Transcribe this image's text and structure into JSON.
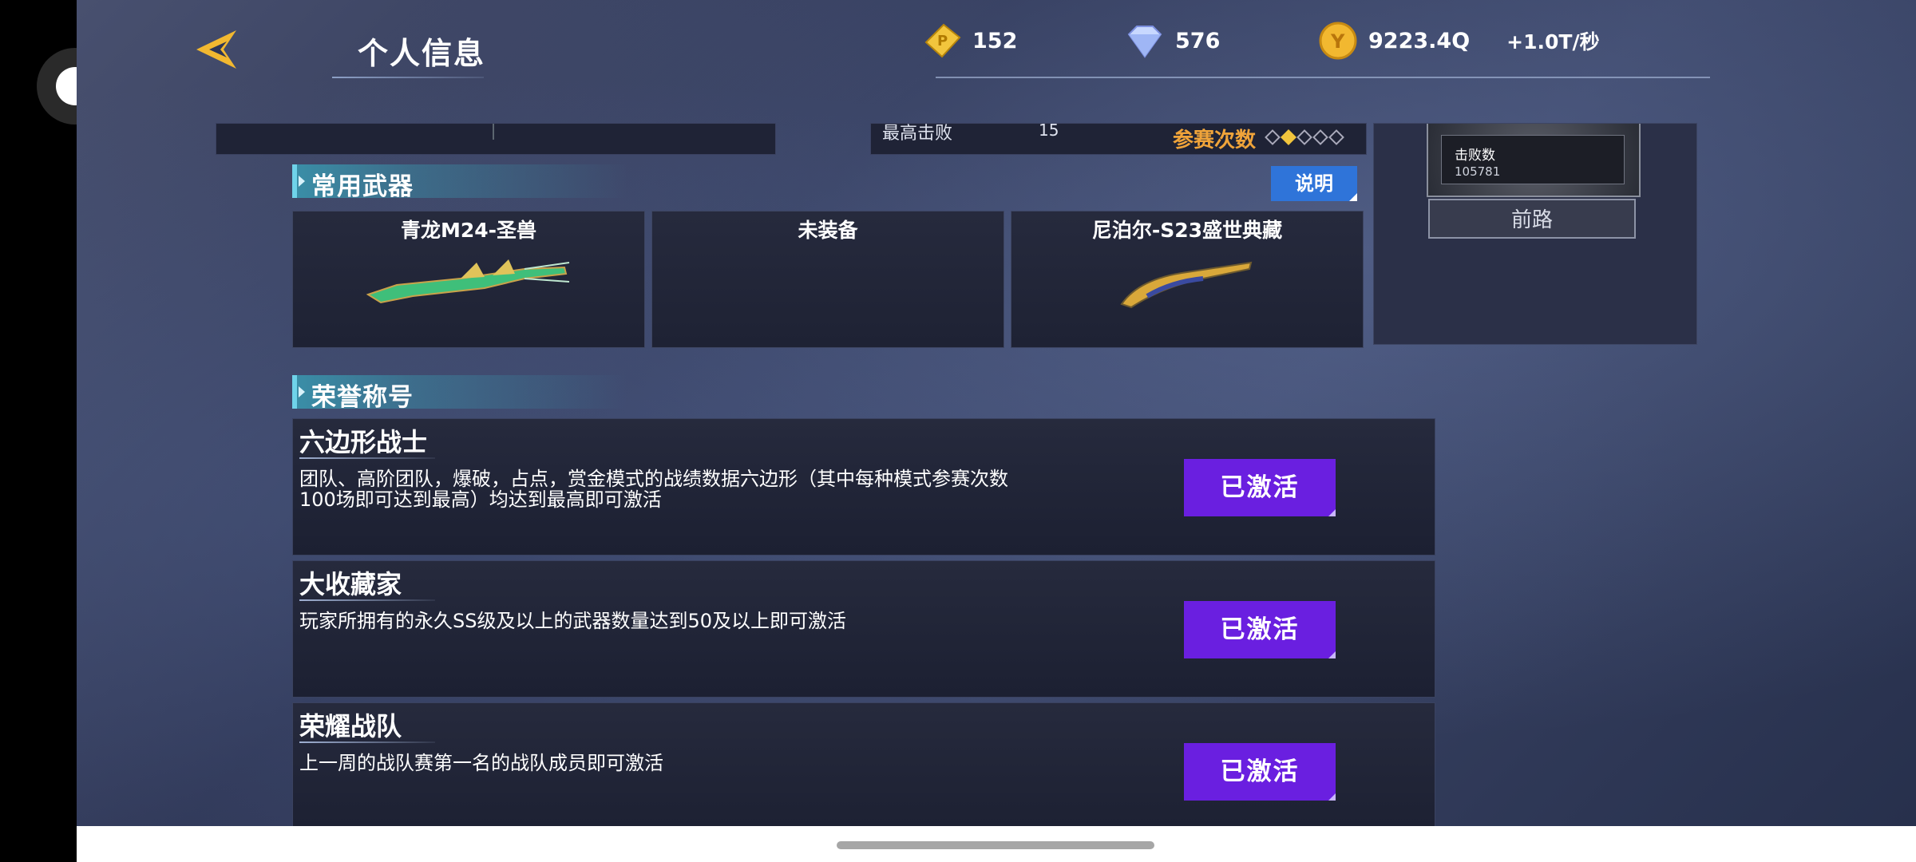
{
  "header": {
    "title": "个人信息",
    "resources": [
      {
        "icon": "gold-ticket-icon",
        "value": "152"
      },
      {
        "icon": "diamond-icon",
        "value": "576"
      },
      {
        "icon": "gold-coin-icon",
        "value": "9223.4Q",
        "rate": "+1.0T/秒"
      }
    ]
  },
  "stats": {
    "label": "最高击败",
    "value": "15",
    "matches_label": "参赛次数",
    "matches_level": 1,
    "matches_max": 5
  },
  "side_card": {
    "kills_label": "击败数",
    "kills_value": "105781",
    "button": "前路"
  },
  "weapons_section": {
    "title": "常用武器",
    "help_button": "说明",
    "items": [
      {
        "name": "青龙M24-圣兽",
        "icon": "dragon-sniper-rifle-icon"
      },
      {
        "name": "未装备",
        "icon": ""
      },
      {
        "name": "尼泊尔-S23盛世典藏",
        "icon": "golden-knife-icon"
      }
    ]
  },
  "honors_section": {
    "title": "荣誉称号",
    "items": [
      {
        "title": "六边形战士",
        "desc": "团队、高阶团队，爆破，占点，赏金模式的战绩数据六边形（其中每种模式参赛次数100场即可达到最高）均达到最高即可激活",
        "status": "已激活"
      },
      {
        "title": "大收藏家",
        "desc": "玩家所拥有的永久SS级及以上的武器数量达到50及以上即可激活",
        "status": "已激活"
      },
      {
        "title": "荣耀战队",
        "desc": "上一周的战队赛第一名的战队成员即可激活",
        "status": "已激活"
      }
    ]
  },
  "colors": {
    "activated": "#6a1fe0",
    "section_accent": "#3a8fa8",
    "matches_label": "#f0a43a"
  }
}
